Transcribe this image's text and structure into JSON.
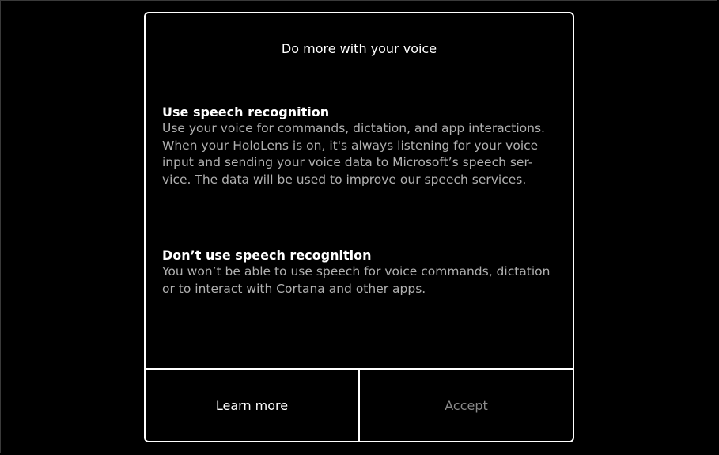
{
  "dialog": {
    "title": "Do more with your voice",
    "options": [
      {
        "heading": "Use speech recognition",
        "lines": [
          "Use your voice for commands, dictation, and app interactions.",
          "When your HoloLens is on, it's always listening for your voice",
          "input and sending your voice data to Microsoft’s speech ser-",
          "vice. The data will be used to improve our speech services."
        ]
      },
      {
        "heading": "Don’t use speech recognition",
        "lines": [
          "You won’t be able to use speech for voice commands, dictation",
          "or to interact with Cortana and other apps."
        ]
      }
    ],
    "buttons": {
      "learn_more": "Learn more",
      "accept": "Accept"
    }
  },
  "colors": {
    "background": "#000000",
    "text_primary": "#ffffff",
    "text_secondary": "#b0b0b0",
    "text_disabled": "#8a8a8a",
    "border": "#ffffff"
  }
}
